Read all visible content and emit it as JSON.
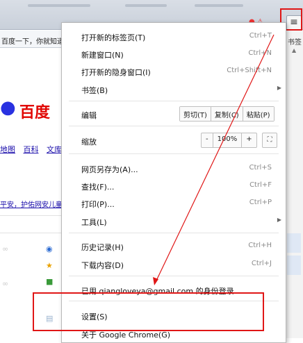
{
  "browser": {
    "tab_text": "百度一下，你就知道",
    "right_label": "书签",
    "menu_button_glyph": "≡",
    "accent_red": "#e01616"
  },
  "background_page": {
    "logo_text": "百度",
    "links": [
      "地图",
      "百科",
      "文库"
    ],
    "notice": "平安，护佑网安儿童"
  },
  "menu": {
    "new_tab": {
      "label": "打开新的标签页(T)",
      "shortcut": "Ctrl+T"
    },
    "new_window": {
      "label": "新建窗口(N)",
      "shortcut": "Ctrl+N"
    },
    "incognito": {
      "label": "打开新的隐身窗口(I)",
      "shortcut": "Ctrl+Shift+N"
    },
    "bookmarks": {
      "label": "书签(B)"
    },
    "edit": {
      "label": "编辑",
      "cut": "剪切(T)",
      "copy": "复制(C)",
      "paste": "粘贴(P)"
    },
    "zoom": {
      "label": "缩放",
      "minus": "-",
      "value": "100%",
      "plus": "+"
    },
    "save_as": {
      "label": "网页另存为(A)...",
      "shortcut": "Ctrl+S"
    },
    "find": {
      "label": "查找(F)...",
      "shortcut": "Ctrl+F"
    },
    "print": {
      "label": "打印(P)...",
      "shortcut": "Ctrl+P"
    },
    "tools": {
      "label": "工具(L)"
    },
    "history": {
      "label": "历史记录(H)",
      "shortcut": "Ctrl+H"
    },
    "downloads": {
      "label": "下载内容(D)",
      "shortcut": "Ctrl+J"
    },
    "signed_in": {
      "label": "已用 qiangloveya@gmail.com 的身份登录..."
    },
    "settings": {
      "label": "设置(S)"
    },
    "about": {
      "label": "关于 Google Chrome(G)"
    }
  }
}
